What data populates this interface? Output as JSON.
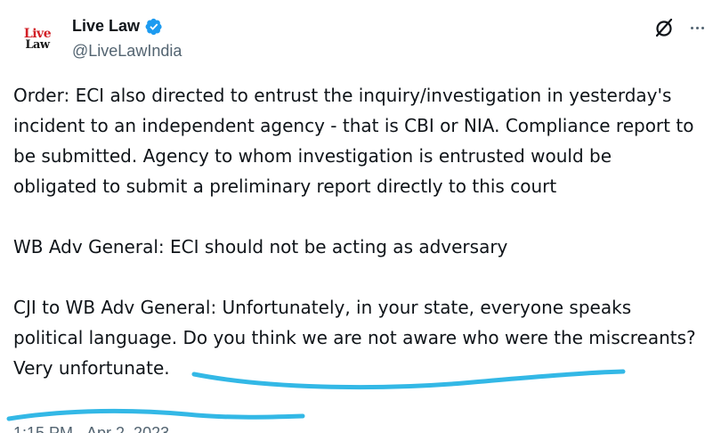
{
  "account": {
    "logo_line1": "Live",
    "logo_line2": "Law",
    "display_name": "Live Law",
    "handle": "@LiveLawIndia",
    "verified": true
  },
  "tweet": {
    "paragraphs": [
      "Order: ECI also directed to entrust the inquiry/investigation in yesterday's incident to an independent agency - that is CBI or NIA. Compliance report to be submitted. Agency to whom investigation is entrusted would be obligated to submit a preliminary report directly to this court",
      "WB Adv General: ECI should not be acting as adversary"
    ],
    "last_paragraph_lead": "CJI to WB Adv General: Unfortunately, in your state, everyone speaks political language. ",
    "last_paragraph_highlight": "Do you think we are not aware who were the miscreants? Very unfortunate.",
    "timestamp_partial": "1:15 PM · Apr 2, 2023 ·"
  },
  "icons": {
    "grok": "grok-icon",
    "more": "more-options-icon",
    "verified": "verified-badge-icon"
  },
  "colors": {
    "verified_blue": "#1d9bf0",
    "text": "#0f1419",
    "secondary": "#536471",
    "logo_red": "#d21f26",
    "annotation": "#33b8e6"
  }
}
